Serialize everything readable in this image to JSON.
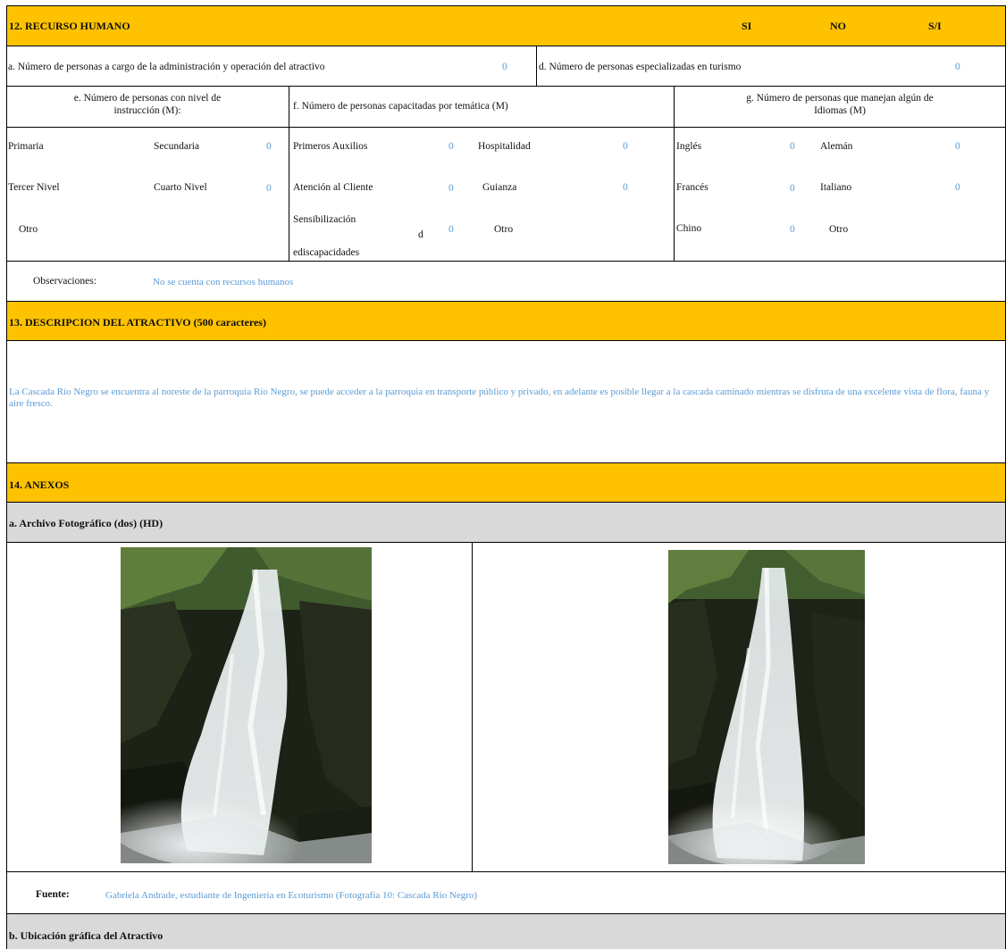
{
  "section12": {
    "title": "12. RECURSO HUMANO",
    "col_si": "SI",
    "col_no": "NO",
    "col_si_info": "S/I",
    "row_a_label": "a. Número de personas a cargo de la administración y operación del atractivo",
    "row_a_value": "0",
    "row_d_label": "d. Número de personas especializadas en turismo",
    "row_d_value": "0",
    "e_label_line1": "e. Número de personas con nivel de",
    "e_label_line2": "instrucción (M):",
    "f_label": "f. Número de personas capacitadas por temática (M)",
    "g_label_line1": "g. Número de personas que manejan algún de",
    "g_label_line2": "Idiomas (M)",
    "primaria": "Primaria",
    "secundaria": "Secundaria",
    "secundaria_value": "0",
    "tercer_nivel": "Tercer Nivel",
    "cuarto_nivel": "Cuarto Nivel",
    "cuarto_nivel_value": "0",
    "otro_e": "Otro",
    "primeros_auxilios": "Primeros Auxilios",
    "primeros_auxilios_value": "0",
    "hospitalidad": "Hospitalidad",
    "hospitalidad_value": "0",
    "atencion_cliente": "Atención al Cliente",
    "atencion_cliente_value": "0",
    "guianza": "Guianza",
    "guianza_value": "0",
    "sensibilizacion_line1": "Sensibilización",
    "sensibilizacion_d": "d",
    "sensibilizacion_line2": "ediscapacidades",
    "sensibilizacion_value": "0",
    "otro_f": "Otro",
    "ingles": "Inglés",
    "ingles_value": "0",
    "aleman": "Alemán",
    "aleman_value": "0",
    "frances": "Francés",
    "frances_value": "0",
    "italiano": "Italiano",
    "italiano_value": "0",
    "chino": "Chino",
    "chino_value": "0",
    "otro_g": "Otro",
    "observaciones_label": "Observaciones:",
    "observaciones_value": "No se cuenta con recursos humanos"
  },
  "section13": {
    "title": "13. DESCRIPCION DEL ATRACTIVO (500 caracteres)",
    "description": "La Cascada Río Negro se encuentra al noreste de la parroquia Río Negro, se puede acceder a la parroquia en transporte público y privado, en adelante es posible llegar a la cascada caminado mientras se disfruta de una excelente vista de flora, fauna y aire fresco."
  },
  "section14": {
    "title": "14. ANEXOS",
    "photo_archive_label": "a. Archivo Fotográfico (dos) (HD)",
    "fuente_label": "Fuente:",
    "fuente_value": "Gabriela Andrade, estudiante de Ingeniería en Ecoturismo (Fotografía 10: Cascada Río Negro)",
    "ubicacion_label": "b. Ubicación gráfica del Atractivo"
  },
  "colors": {
    "header_bg": "#fec200",
    "subheader_bg": "#d9d9d9",
    "value_text": "#5b9bd5"
  }
}
